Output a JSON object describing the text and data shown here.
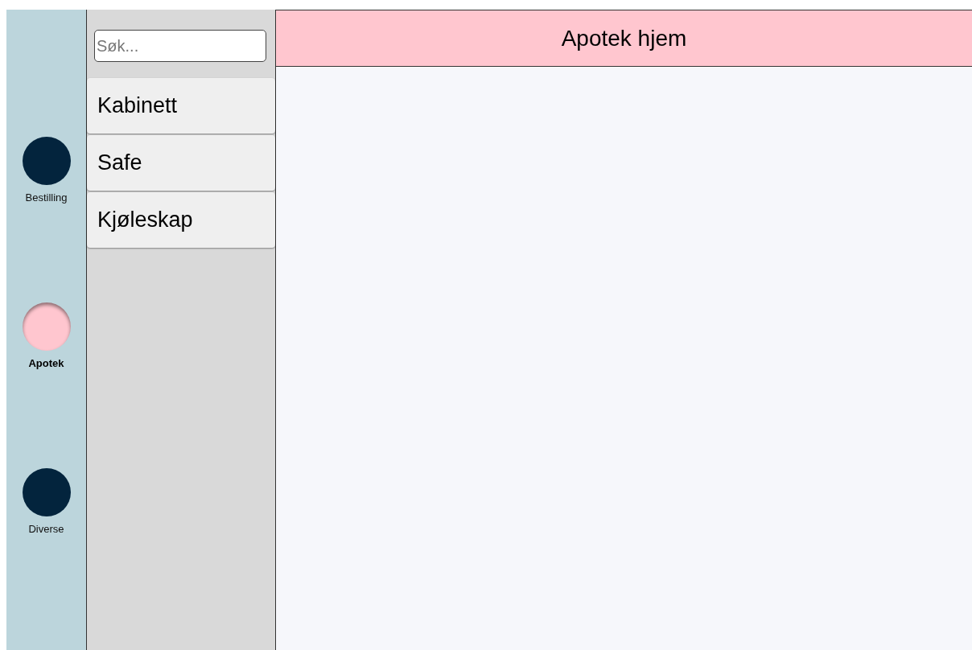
{
  "nav": [
    {
      "label": "Bestilling",
      "selected": false
    },
    {
      "label": "Apotek",
      "selected": true
    },
    {
      "label": "Diverse",
      "selected": false
    }
  ],
  "search": {
    "placeholder": "Søk..."
  },
  "list": [
    {
      "label": "Kabinett"
    },
    {
      "label": "Safe"
    },
    {
      "label": "Kjøleskap"
    }
  ],
  "header": {
    "title": "Apotek hjem"
  }
}
